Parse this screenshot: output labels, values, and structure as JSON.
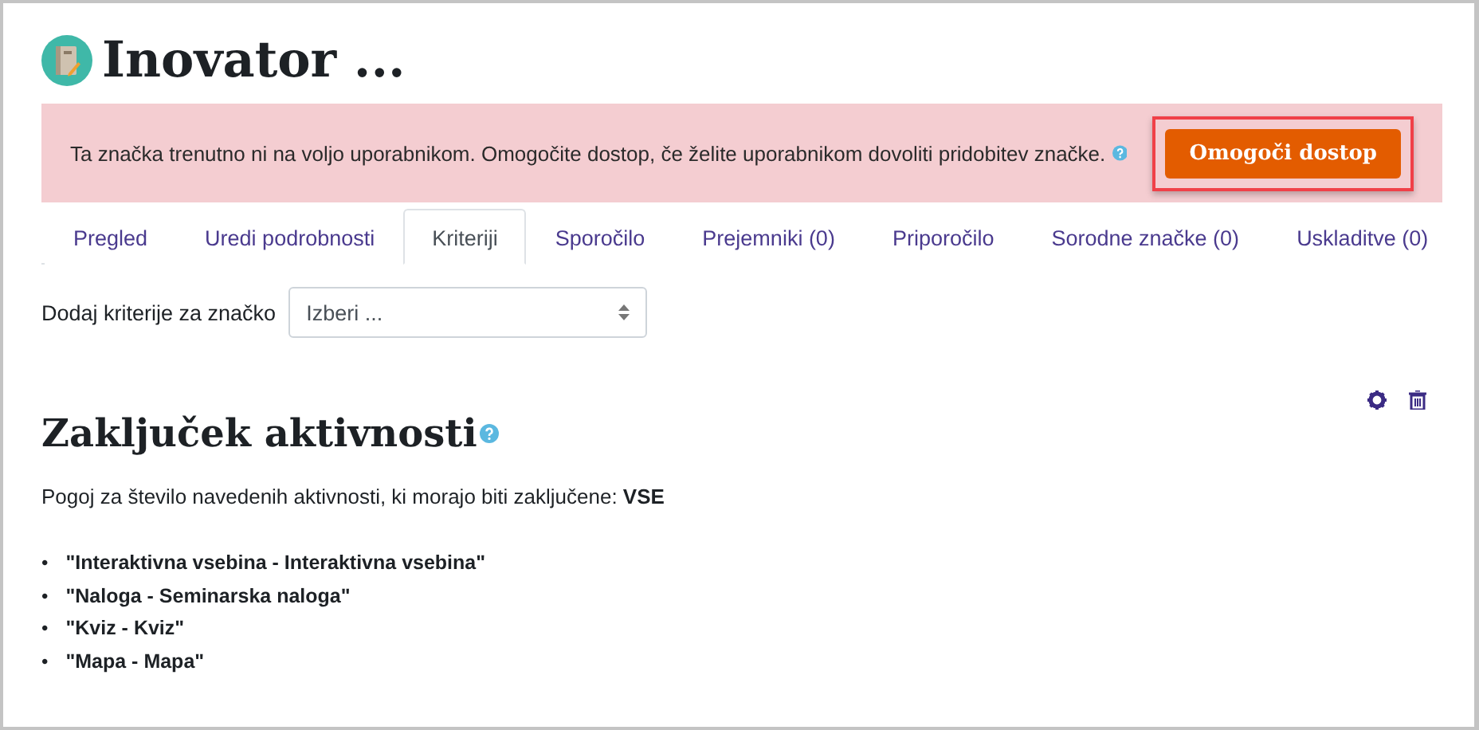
{
  "title": "Inovator ...",
  "alert": {
    "message": "Ta značka trenutno ni na voljo uporabnikom. Omogočite dostop, če želite uporabnikom dovoliti pridobitev značke.",
    "button": "Omogoči dostop"
  },
  "tabs": [
    {
      "label": "Pregled",
      "selected": false
    },
    {
      "label": "Uredi podrobnosti",
      "selected": false
    },
    {
      "label": "Kriteriji",
      "selected": true
    },
    {
      "label": "Sporočilo",
      "selected": false
    },
    {
      "label": "Prejemniki (0)",
      "selected": false
    },
    {
      "label": "Priporočilo",
      "selected": false
    },
    {
      "label": "Sorodne značke (0)",
      "selected": false
    },
    {
      "label": "Uskladitve (0)",
      "selected": false
    }
  ],
  "add_criteria": {
    "label": "Dodaj kriterije za značko",
    "value": "Izberi ..."
  },
  "section": {
    "heading": "Zaključek aktivnosti",
    "condition": "Pogoj za število navedenih aktivnosti, ki morajo biti zaključene: **VSE**",
    "activities": [
      {
        "bullet": "•",
        "text": "\"Interaktivna vsebina - Interaktivna vsebina\""
      },
      {
        "bullet": "•",
        "text": "\"Naloga - Seminarska naloga\""
      },
      {
        "bullet": "•",
        "text": "\"Kviz - Kviz\""
      },
      {
        "bullet": "•",
        "text": "\"Mapa - Mapa\""
      }
    ]
  }
}
